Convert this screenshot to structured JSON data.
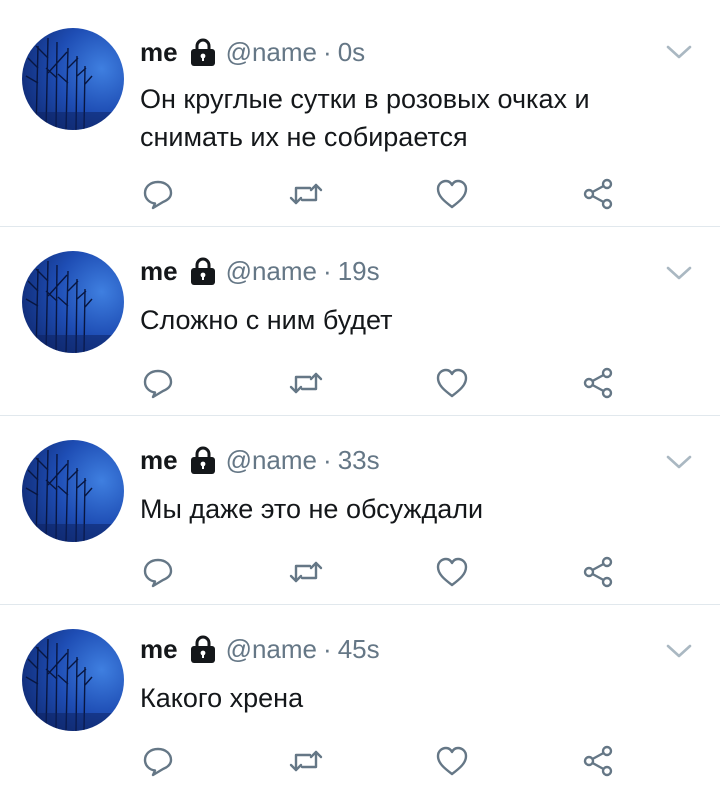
{
  "tweets": [
    {
      "name": "me",
      "handle": "@name",
      "separator": "·",
      "time": "0s",
      "text": "Он круглые сутки в розовых очках и снимать их не собирается"
    },
    {
      "name": "me",
      "handle": "@name",
      "separator": "·",
      "time": "19s",
      "text": "Сложно с ним будет"
    },
    {
      "name": "me",
      "handle": "@name",
      "separator": "·",
      "time": "33s",
      "text": "Мы даже это не обсуждали"
    },
    {
      "name": "me",
      "handle": "@name",
      "separator": "·",
      "time": "45s",
      "text": "Какого хрена"
    }
  ],
  "icons": {
    "lock": "lock-icon",
    "menu": "chevron-down-icon",
    "reply": "reply-icon",
    "retweet": "retweet-icon",
    "like": "heart-icon",
    "share": "share-icon"
  },
  "colors": {
    "text": "#14171a",
    "secondary": "#657786",
    "icon": "#657786",
    "divider": "#e1e8ed",
    "avatar": "#1e4db4"
  }
}
